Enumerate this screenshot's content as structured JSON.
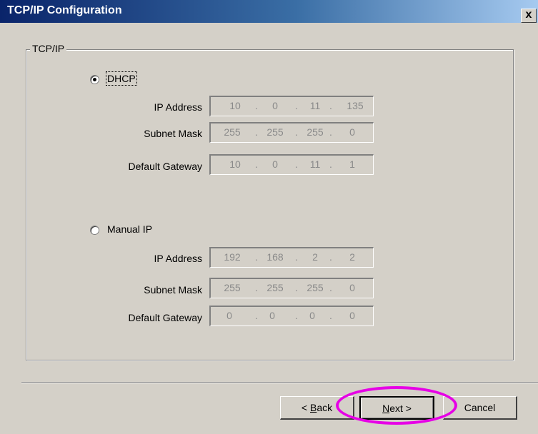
{
  "window": {
    "title": "TCP/IP Configuration",
    "close_label": "x"
  },
  "group": {
    "legend": "TCP/IP"
  },
  "dhcp": {
    "label": "DHCP",
    "selected": true,
    "ip_label": "IP Address",
    "ip": [
      "10",
      "0",
      "11",
      "135"
    ],
    "mask_label": "Subnet Mask",
    "mask": [
      "255",
      "255",
      "255",
      "0"
    ],
    "gateway_label": "Default Gateway",
    "gateway": [
      "10",
      "0",
      "11",
      "1"
    ]
  },
  "manual": {
    "label": "Manual IP",
    "selected": false,
    "ip_label": "IP Address",
    "ip": [
      "192",
      "168",
      "2",
      "2"
    ],
    "mask_label": "Subnet Mask",
    "mask": [
      "255",
      "255",
      "255",
      "0"
    ],
    "gateway_label": "Default Gateway",
    "gateway": [
      "0",
      "0",
      "0",
      "0"
    ]
  },
  "buttons": {
    "back_prefix": "< ",
    "back_mnemonic": "B",
    "back_rest": "ack",
    "next_mnemonic": "N",
    "next_rest": "ext >",
    "cancel": "Cancel"
  },
  "highlight_color": "#e600e6"
}
